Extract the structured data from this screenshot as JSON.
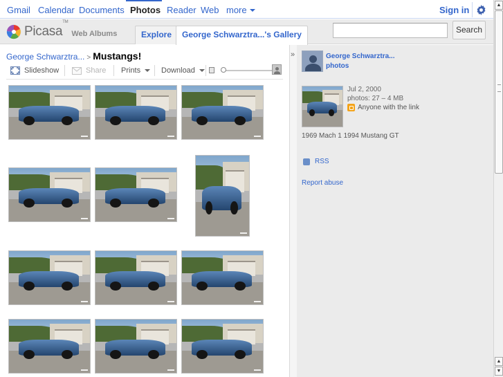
{
  "gbar": {
    "links": [
      "Gmail",
      "Calendar",
      "Documents",
      "Photos",
      "Reader",
      "Web",
      "more"
    ],
    "active": "Photos",
    "signin": "Sign in",
    "settings_icon": "gear-icon"
  },
  "header": {
    "logo_word": "Picasa",
    "logo_tm": "TM",
    "logo_sub": "Web Albums",
    "tabs": [
      "Explore",
      "George Schwarztra...'s Gallery"
    ],
    "search_value": "",
    "search_button": "Search"
  },
  "breadcrumb": {
    "owner": "George Schwarztra...",
    "separator": ">",
    "album": "Mustangs!"
  },
  "toolbar": {
    "slideshow": "Slideshow",
    "share": "Share",
    "prints": "Prints",
    "download": "Download",
    "zoom_level": 0.05
  },
  "photos": [
    {
      "orientation": "landscape"
    },
    {
      "orientation": "landscape"
    },
    {
      "orientation": "landscape"
    },
    {
      "orientation": "landscape"
    },
    {
      "orientation": "landscape"
    },
    {
      "orientation": "portrait"
    },
    {
      "orientation": "landscape"
    },
    {
      "orientation": "landscape"
    },
    {
      "orientation": "landscape"
    },
    {
      "orientation": "landscape"
    },
    {
      "orientation": "landscape"
    },
    {
      "orientation": "landscape"
    }
  ],
  "sidebar": {
    "owner_name": "George Schwarztra...",
    "owner_photos_link": "photos",
    "date": "Jul 2, 2000",
    "photos_info": "photos: 27 – 4 MB",
    "visibility": "Anyone with the link",
    "description": "1969 Mach 1 1994 Mustang GT",
    "rss": "RSS",
    "report": "Report abuse"
  },
  "colors": {
    "link": "#3366cc",
    "header_bg": "#ebebeb",
    "visibility_icon": "#f4a318"
  }
}
